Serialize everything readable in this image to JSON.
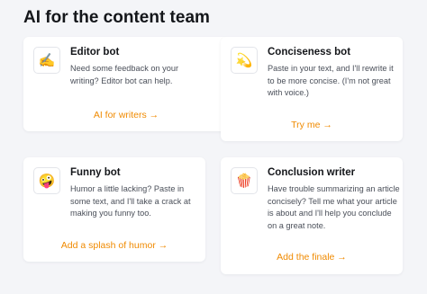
{
  "page": {
    "title": "AI for the content team"
  },
  "cards": [
    {
      "icon": "writing-hand-icon",
      "glyph": "✍️",
      "title": "Editor bot",
      "description": "Need some feedback on your writing? Editor bot can help.",
      "link": "AI for writers →"
    },
    {
      "icon": "dizzy-icon",
      "glyph": "💫",
      "title": "Conciseness bot",
      "description": "Paste in your text, and I'll rewrite it to be more concise. (I'm not great with voice.)",
      "link": "Try me →"
    },
    {
      "icon": "zany-face-icon",
      "glyph": "🤪",
      "title": "Funny bot",
      "description": "Humor a little lacking? Paste in some text, and I'll take a crack at making you funny too.",
      "link": "Add a splash of humor →"
    },
    {
      "icon": "popcorn-icon",
      "glyph": "🍿",
      "title": "Conclusion writer",
      "description": "Have trouble summarizing an article concisely? Tell me what your article is about and I'll help you conclude on a great note.",
      "link": "Add the finale →"
    }
  ],
  "colors": {
    "accent": "#f08a00",
    "background": "#f4f5f8",
    "card": "#ffffff"
  }
}
